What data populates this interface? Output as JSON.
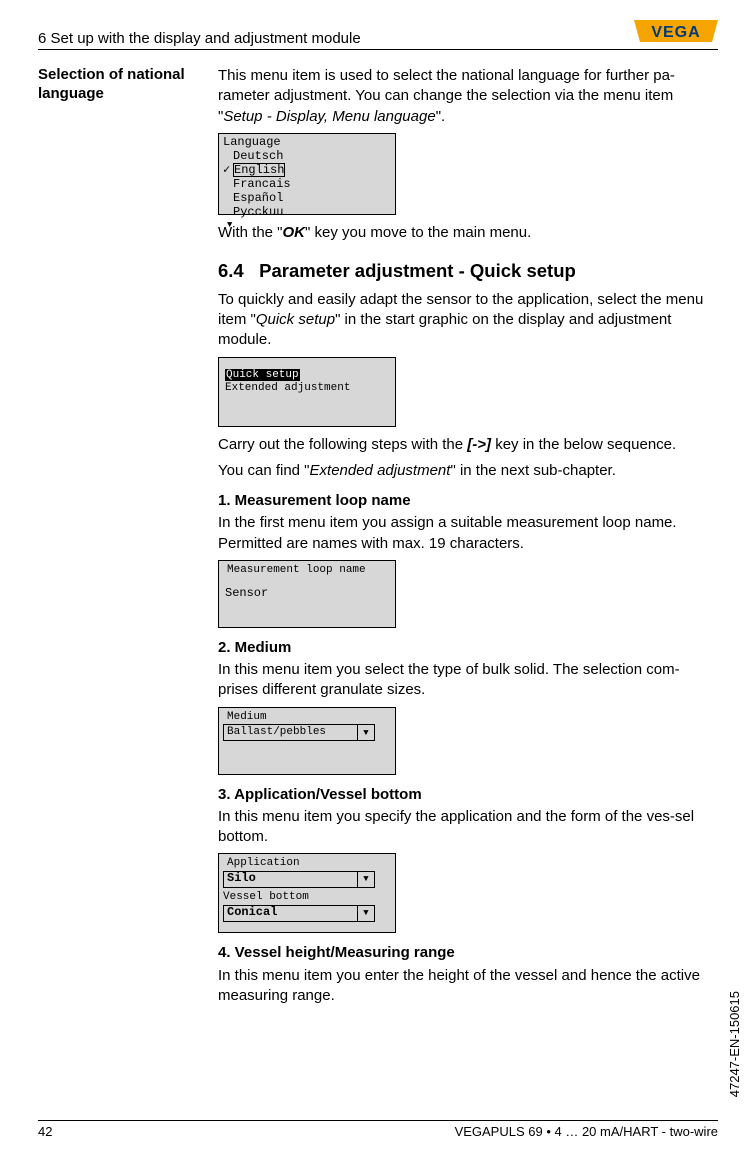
{
  "header": {
    "chapter": "6 Set up with the display and adjustment module",
    "logo_text": "VEGA"
  },
  "margin": {
    "label": "Selection of national language"
  },
  "intro": {
    "p1_a": "This menu item is used to select the national language for further pa-rameter adjustment. You can change the selection via the menu item \"",
    "p1_ital": "Setup - Display, Menu language",
    "p1_b": "\".",
    "lcd_lang_title": "Language",
    "lcd_lang_items": [
      "Deutsch",
      "English",
      "Francais",
      "Español",
      "Pycckuu"
    ],
    "p2_a": "With the \"",
    "p2_ok": "OK",
    "p2_b": "\" key you move to the main menu."
  },
  "s64": {
    "heading_num": "6.4",
    "heading_text": "Parameter adjustment - Quick setup",
    "p1_a": "To quickly and easily adapt the sensor to the application, select the menu item \"",
    "p1_ital": "Quick setup",
    "p1_b": "\" in the start graphic on the display and adjustment module.",
    "lcd_quick_sel": "Quick setup",
    "lcd_quick_line2": "Extended adjustment",
    "p2_a": "Carry out the following steps with the ",
    "p2_key": "[->]",
    "p2_b": " key in the below sequence.",
    "p3_a": "You can find \"",
    "p3_ital": "Extended adjustment",
    "p3_b": "\" in the next sub-chapter."
  },
  "step1": {
    "title": "1. Measurement loop name",
    "p": "In the first menu item you assign a suitable measurement loop name. Permitted are names with max. 19 characters.",
    "lcd_title": "Measurement loop name",
    "lcd_value": "Sensor"
  },
  "step2": {
    "title": "2. Medium",
    "p": "In this menu item you select the type of bulk solid. The selection com-prises different granulate sizes.",
    "lcd_title": "Medium",
    "lcd_value": "Ballast/pebbles"
  },
  "step3": {
    "title": "3. Application/Vessel bottom",
    "p": "In this menu item you specify the application and the form of the ves-sel bottom.",
    "lcd_t1": "Application",
    "lcd_v1": "Silo",
    "lcd_t2": "Vessel bottom",
    "lcd_v2": "Conical"
  },
  "step4": {
    "title": "4. Vessel height/Measuring range",
    "p": "In this menu item you enter the height of the vessel and hence the active measuring range."
  },
  "footer": {
    "page": "42",
    "product": "VEGAPULS 69 • 4 … 20 mA/HART - two-wire",
    "docid": "47247-EN-150615"
  }
}
